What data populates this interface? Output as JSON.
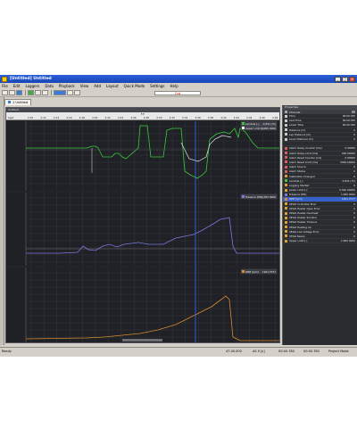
{
  "window": {
    "title": "[Untitled] Untitled",
    "minimize_glyph": "_",
    "maximize_glyph": "□",
    "close_glyph": "×"
  },
  "menu": [
    "File",
    "Edit",
    "Loggers",
    "Data",
    "Playback",
    "View",
    "Add",
    "Layout",
    "Quick Mode",
    "Settings",
    "Help"
  ],
  "toolbar": {
    "output_label": "Out"
  },
  "doc_tab": {
    "label": "1 Untitled"
  },
  "main_panel": {
    "header": "Untitled",
    "ruler_title": "F.F.",
    "ruler_first_label": "Sept",
    "time_ticks": [
      "2:10",
      "2:12",
      "2:14",
      "2:16",
      "2:18",
      "2:20",
      "2:22",
      "2:24",
      "2:26",
      "2:28",
      "2:30",
      "2:32",
      "2:34",
      "2:36",
      "2:38",
      "2:40",
      "2:42",
      "2:44",
      "2:46",
      "2:48"
    ]
  },
  "legends": {
    "plot1": [
      {
        "label": "Lambda [-]",
        "value": "0.831 [?h]",
        "color": "#3ac93a"
      },
      {
        "label": "Upper Limit [-]",
        "value": "1.000 0000",
        "color": "#eeeeee"
      }
    ],
    "plot2": {
      "label": "Pressure [PSI]",
      "value": "1.000 0000",
      "color": "#7a7ae0"
    },
    "plot3": {
      "label": "RPM [rpm]",
      "value": "1261.7077",
      "color": "#d98a2e"
    }
  },
  "channel_panel": {
    "header": "Properties",
    "top_label": "Channel",
    "rows": [
      {
        "name": "Time",
        "value": "00:00.780",
        "color": "#c9c9c9"
      },
      {
        "name": "Last Time",
        "value": "00:00.780",
        "color": "#c9c9c9"
      },
      {
        "name": "Lower Time",
        "value": "00:00.780",
        "color": "#c9c9c9"
      },
      {
        "name": "Distance [m]",
        "value": "0",
        "color": "#c9c9c9"
      },
      {
        "name": "Lap Distance [m]",
        "value": "0",
        "color": "#c9c9c9"
      },
      {
        "name": "Lever Distance [m]",
        "value": "0",
        "color": "#c9c9c9"
      },
      {
        "name": "",
        "value": "",
        "color": "#2a2c30"
      },
      {
        "name": "Alarm Delay Counter [ms]",
        "value": "0.00000",
        "color": "#e05a5a"
      },
      {
        "name": "Alarm Delay Limit [ms]",
        "value": "200.00000",
        "color": "#e05a5a"
      },
      {
        "name": "Alarm Reset Counter [ms]",
        "value": "0.00000",
        "color": "#e05a5a"
      },
      {
        "name": "Alarm Reset Limit [ms]",
        "value": "5000.00000",
        "color": "#e05a5a"
      },
      {
        "name": "Alarm Source",
        "value": "0",
        "color": "#e05a5a"
      },
      {
        "name": "Alarm Status",
        "value": "0",
        "color": "#e05a5a"
      },
      {
        "name": "Calibration Changed",
        "value": "0",
        "color": "#e0a030"
      },
      {
        "name": "Lambda [-]",
        "value": "0.831 [?h]",
        "color": "#3ac93a"
      },
      {
        "name": "Logging Started",
        "value": "0",
        "color": "#e0a030"
      },
      {
        "name": "Lower Limit [-]",
        "value": "0.540 00000",
        "color": "#e0a030"
      },
      {
        "name": "Pressure [PSI]",
        "value": "1.000 0000",
        "color": "#7a7ae0"
      },
      {
        "name": "RPM [rpm]",
        "value": "1261.7077",
        "color": "#d98a2e",
        "selected": true
      },
      {
        "name": "UEGO Controller Error",
        "value": "0",
        "color": "#e0a030"
      },
      {
        "name": "UEGO Heater Open Error",
        "value": "0",
        "color": "#e0a030"
      },
      {
        "name": "UEGO Heater Overheat",
        "value": "0",
        "color": "#e0a030"
      },
      {
        "name": "UEGO Heater Shorted",
        "value": "0",
        "color": "#e0a030"
      },
      {
        "name": "UEGO Heater Timeout",
        "value": "0",
        "color": "#e0a030"
      },
      {
        "name": "UEGO Heating Up",
        "value": "0",
        "color": "#e0a030"
      },
      {
        "name": "UEGO Low Voltage Error",
        "value": "0",
        "color": "#e0a030"
      },
      {
        "name": "UEGO Ready",
        "value": "0",
        "color": "#e0a030"
      },
      {
        "name": "Upper Limit [-]",
        "value": "1.000 0000",
        "color": "#e0a030"
      }
    ]
  },
  "statusbar": {
    "left": "Ready",
    "s1": "47.00.000",
    "s2": "AS 0 [s]",
    "s3": "00:00.780",
    "s4": "00:00.780",
    "mode": "Project Mode"
  },
  "colors": {
    "plot_bg": "#1f2126",
    "grid": "#3a3d45",
    "cursor": "#3b6fff",
    "lambda": "#3ac93a",
    "limit": "#e8e8e8",
    "pressure": "#7a7ae0",
    "rpm": "#d98a2e"
  }
}
